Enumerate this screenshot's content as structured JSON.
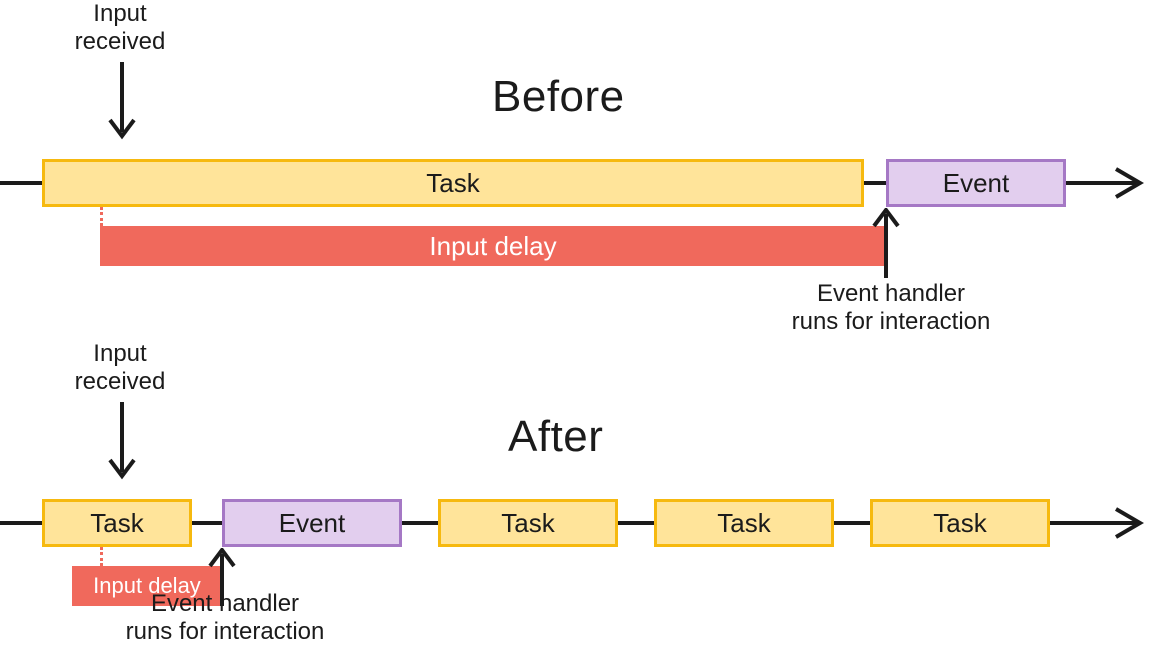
{
  "labels": {
    "before_heading": "Before",
    "after_heading": "After",
    "input_received": "Input\nreceived",
    "task": "Task",
    "event": "Event",
    "input_delay": "Input delay",
    "event_handler": "Event handler\nruns for interaction"
  },
  "colors": {
    "task_fill": "#ffe49a",
    "task_border": "#f6b90f",
    "event_fill": "#e2ceee",
    "event_border": "#a578c5",
    "delay_fill": "#f0695c",
    "ink": "#1b1b1b"
  }
}
